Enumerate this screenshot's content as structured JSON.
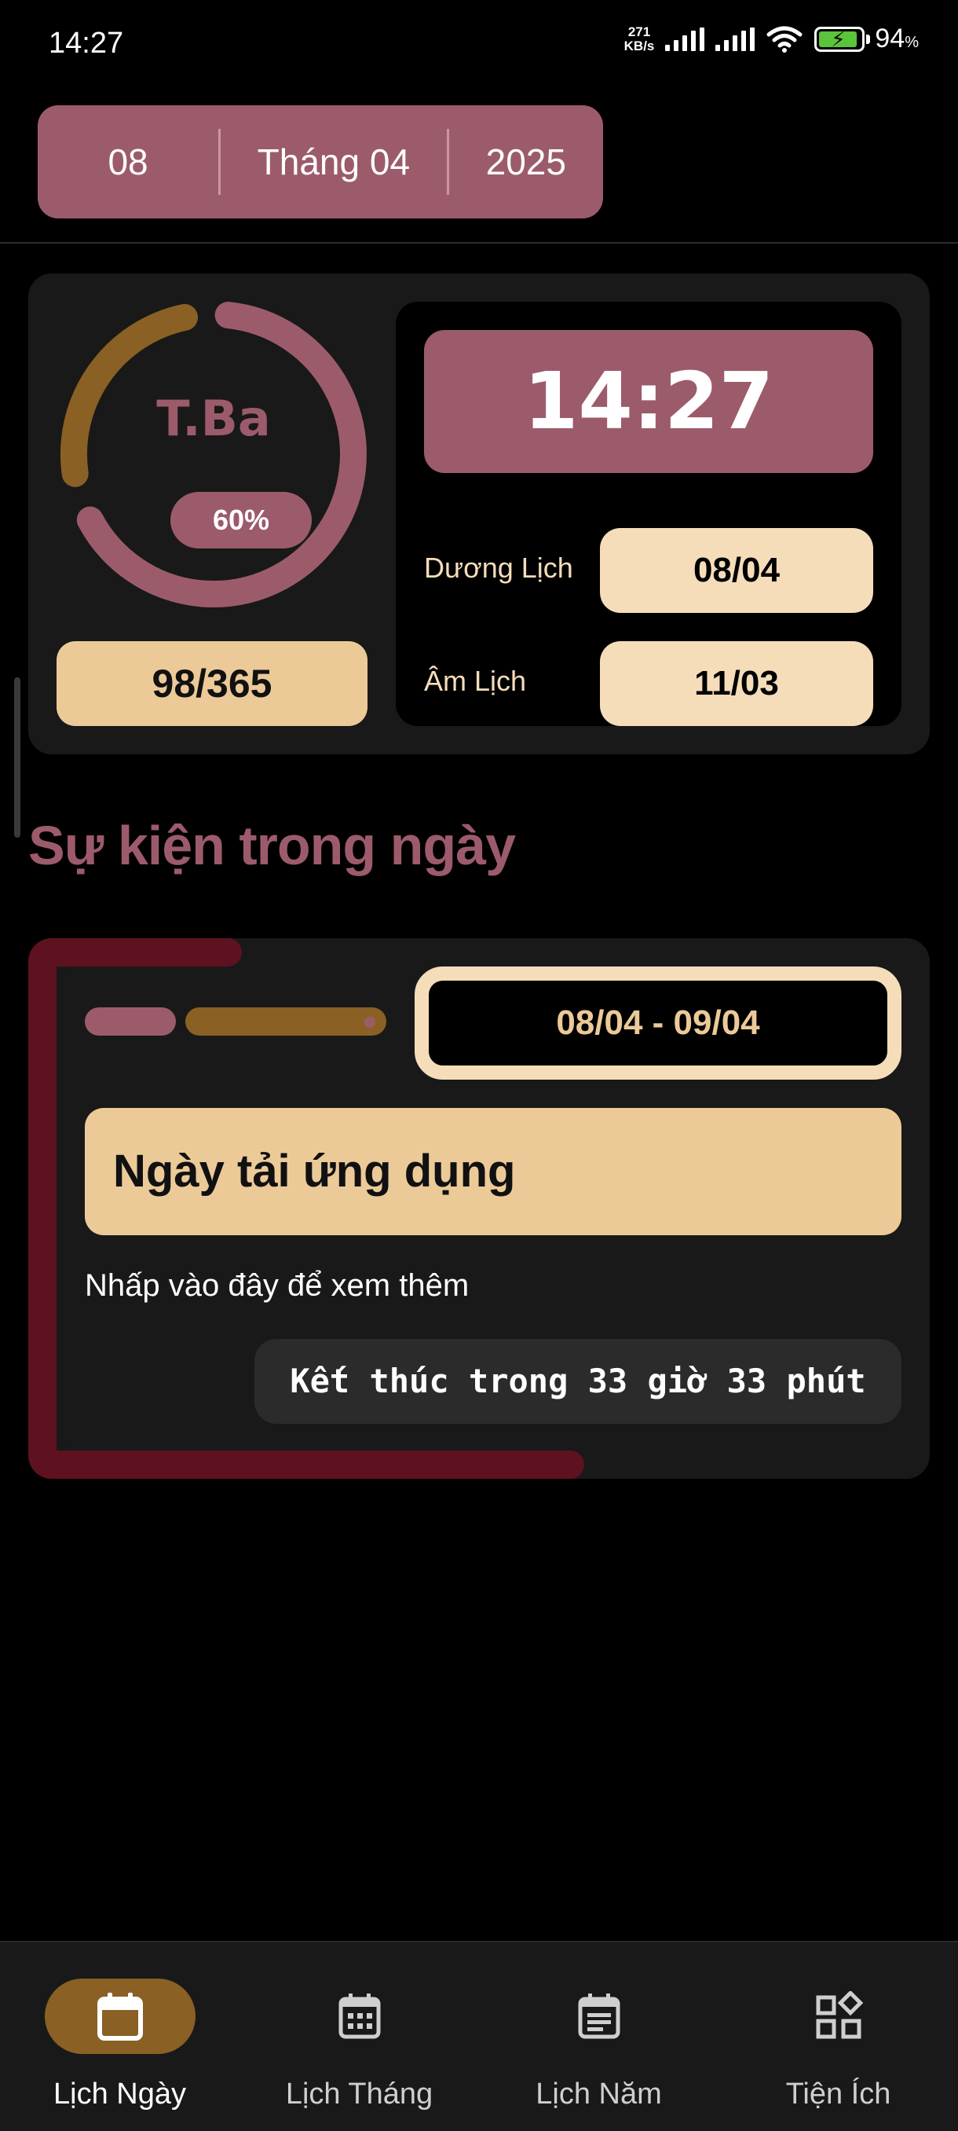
{
  "status_bar": {
    "time": "14:27",
    "net_speed_value": "271",
    "net_speed_unit": "KB/s",
    "battery_percent": "94",
    "battery_unit": "%"
  },
  "date_picker": {
    "day": "08",
    "month": "Tháng 04",
    "year": "2025"
  },
  "today_card": {
    "weekday": "T.Ba",
    "year_progress_label": "60%",
    "year_progress_fraction": 0.6,
    "day_of_year": "98/365",
    "clock": "14:27",
    "solar_label": "Dương Lịch",
    "solar_date": "08/04",
    "lunar_label": "Âm Lịch",
    "lunar_date": "11/03"
  },
  "events_section": {
    "title": "Sự kiện trong ngày",
    "events": [
      {
        "date_range": "08/04 - 09/04",
        "title": "Ngày tải ứng dụng",
        "description": "Nhấp vào đây để xem thêm",
        "ends_in": "Kết thúc trong 33 giờ 33 phút"
      }
    ]
  },
  "bottom_nav": {
    "items": [
      {
        "label": "Lịch Ngày",
        "icon": "calendar-day-icon",
        "active": true
      },
      {
        "label": "Lịch Tháng",
        "icon": "calendar-month-icon",
        "active": false
      },
      {
        "label": "Lịch Năm",
        "icon": "calendar-year-icon",
        "active": false
      },
      {
        "label": "Tiện Ích",
        "icon": "widgets-icon",
        "active": false
      }
    ]
  },
  "colors": {
    "rose": "#9c5b6b",
    "gold": "#8a6024",
    "cream": "#ecca98",
    "light_cream": "#f5ddba",
    "maroon": "#5e1220",
    "card": "#191919"
  }
}
